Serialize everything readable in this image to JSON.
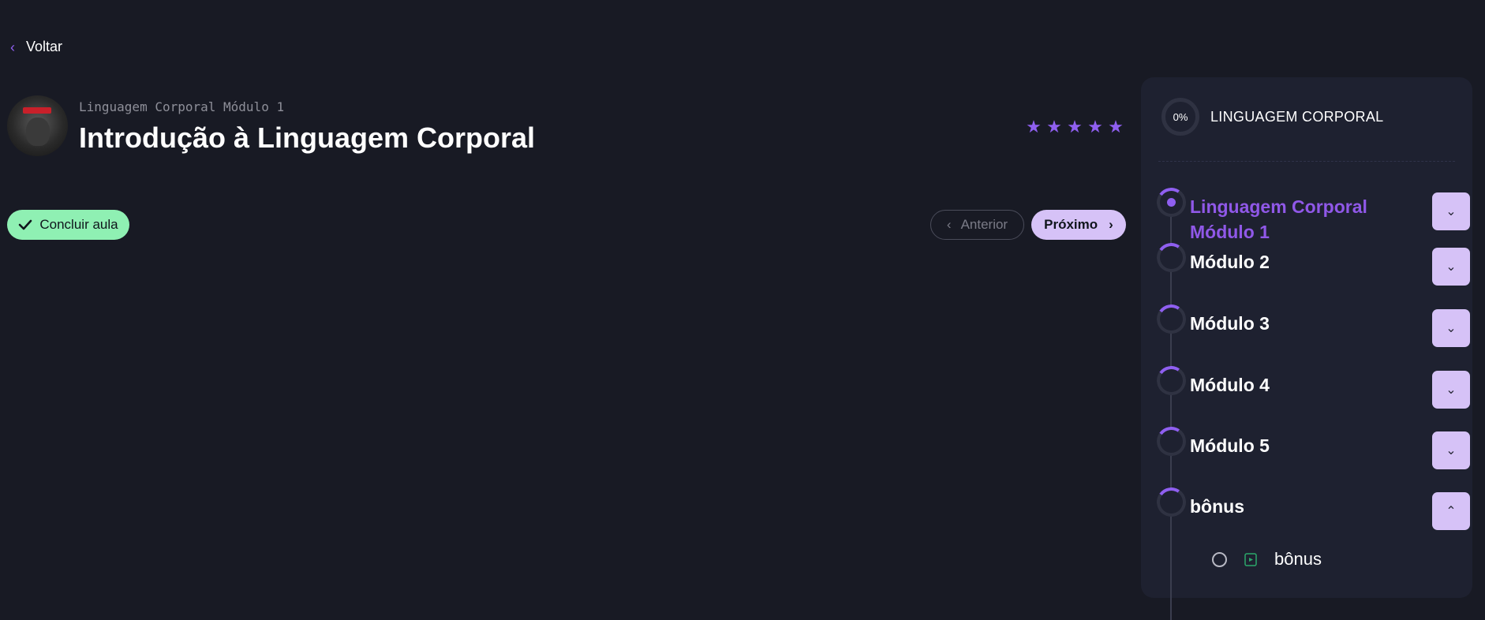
{
  "back": {
    "label": "Voltar"
  },
  "lesson_header": {
    "module_label": "Linguagem Corporal Módulo 1",
    "title": "Introdução à Linguagem Corporal"
  },
  "rating": {
    "stars": 5
  },
  "actions": {
    "complete_label": "Concluir aula",
    "prev_label": "Anterior",
    "next_label": "Próximo"
  },
  "sidebar": {
    "progress": "0%",
    "course_title": "LINGUAGEM CORPORAL",
    "modules": [
      {
        "label": "Linguagem Corporal Módulo 1",
        "active": true,
        "expanded": false
      },
      {
        "label": "Módulo 2",
        "active": false,
        "expanded": false
      },
      {
        "label": "Módulo 3",
        "active": false,
        "expanded": false
      },
      {
        "label": "Módulo 4",
        "active": false,
        "expanded": false
      },
      {
        "label": "Módulo 5",
        "active": false,
        "expanded": false
      },
      {
        "label": "bônus",
        "active": false,
        "expanded": true
      }
    ],
    "lessons": [
      {
        "label": "bônus"
      }
    ]
  },
  "colors": {
    "background": "#181a24",
    "accent": "#8f5ff0",
    "complete_button": "#8ff0b3",
    "next_button": "#d6c2f7"
  }
}
